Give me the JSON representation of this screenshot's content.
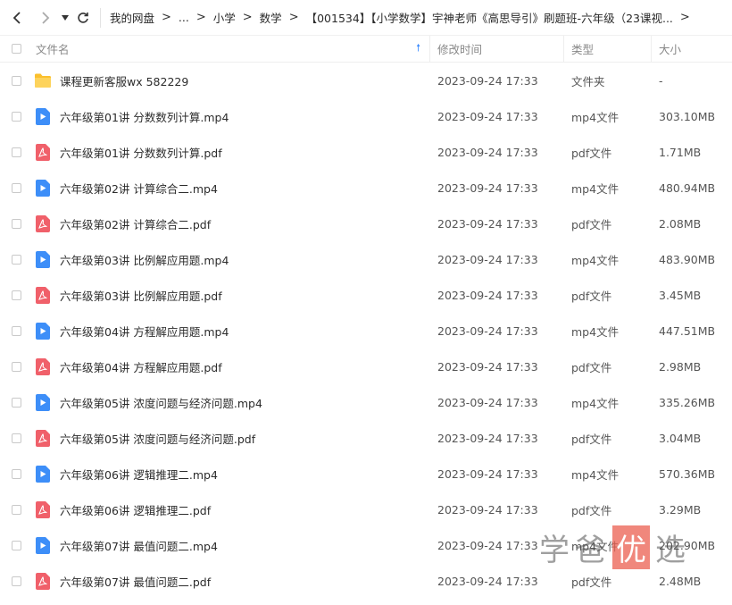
{
  "nav": {
    "back_icon": "chevron-left-icon",
    "forward_icon": "chevron-right-icon",
    "dropdown_icon": "caret-down-icon",
    "refresh_icon": "refresh-icon"
  },
  "breadcrumb": {
    "items": [
      "我的网盘",
      "...",
      "小学",
      "数学",
      "【001534】【小学数学】宇神老师《高思导引》刷题班-六年级（23课视..."
    ],
    "separator": ">"
  },
  "columns": {
    "name": "文件名",
    "date": "修改时间",
    "type": "类型",
    "size": "大小"
  },
  "colors": {
    "folder": "#fbc02d",
    "video": "#3d8ef8",
    "pdf": "#f0606a",
    "sort_arrow": "#3b8cff"
  },
  "files": [
    {
      "icon": "folder-icon",
      "name": "课程更新客服wx 582229",
      "date": "2023-09-24 17:33",
      "type": "文件夹",
      "size": "-"
    },
    {
      "icon": "video-file-icon",
      "name": "六年级第01讲 分数数列计算.mp4",
      "date": "2023-09-24 17:33",
      "type": "mp4文件",
      "size": "303.10MB"
    },
    {
      "icon": "pdf-file-icon",
      "name": "六年级第01讲 分数数列计算.pdf",
      "date": "2023-09-24 17:33",
      "type": "pdf文件",
      "size": "1.71MB"
    },
    {
      "icon": "video-file-icon",
      "name": "六年级第02讲 计算综合二.mp4",
      "date": "2023-09-24 17:33",
      "type": "mp4文件",
      "size": "480.94MB"
    },
    {
      "icon": "pdf-file-icon",
      "name": "六年级第02讲 计算综合二.pdf",
      "date": "2023-09-24 17:33",
      "type": "pdf文件",
      "size": "2.08MB"
    },
    {
      "icon": "video-file-icon",
      "name": "六年级第03讲 比例解应用题.mp4",
      "date": "2023-09-24 17:33",
      "type": "mp4文件",
      "size": "483.90MB"
    },
    {
      "icon": "pdf-file-icon",
      "name": "六年级第03讲 比例解应用题.pdf",
      "date": "2023-09-24 17:33",
      "type": "pdf文件",
      "size": "3.45MB"
    },
    {
      "icon": "video-file-icon",
      "name": "六年级第04讲 方程解应用题.mp4",
      "date": "2023-09-24 17:33",
      "type": "mp4文件",
      "size": "447.51MB"
    },
    {
      "icon": "pdf-file-icon",
      "name": "六年级第04讲 方程解应用题.pdf",
      "date": "2023-09-24 17:33",
      "type": "pdf文件",
      "size": "2.98MB"
    },
    {
      "icon": "video-file-icon",
      "name": "六年级第05讲 浓度问题与经济问题.mp4",
      "date": "2023-09-24 17:33",
      "type": "mp4文件",
      "size": "335.26MB"
    },
    {
      "icon": "pdf-file-icon",
      "name": "六年级第05讲 浓度问题与经济问题.pdf",
      "date": "2023-09-24 17:33",
      "type": "pdf文件",
      "size": "3.04MB"
    },
    {
      "icon": "video-file-icon",
      "name": "六年级第06讲 逻辑推理二.mp4",
      "date": "2023-09-24 17:33",
      "type": "mp4文件",
      "size": "570.36MB"
    },
    {
      "icon": "pdf-file-icon",
      "name": "六年级第06讲 逻辑推理二.pdf",
      "date": "2023-09-24 17:33",
      "type": "pdf文件",
      "size": "3.29MB"
    },
    {
      "icon": "video-file-icon",
      "name": "六年级第07讲 最值问题二.mp4",
      "date": "2023-09-24 17:33",
      "type": "mp4文件",
      "size": "202.90MB"
    },
    {
      "icon": "pdf-file-icon",
      "name": "六年级第07讲 最值问题二.pdf",
      "date": "2023-09-24 17:33",
      "type": "pdf文件",
      "size": "2.48MB"
    }
  ],
  "watermark": {
    "text_1": "学",
    "text_2": "爸",
    "text_3": "优",
    "text_4": "选"
  }
}
